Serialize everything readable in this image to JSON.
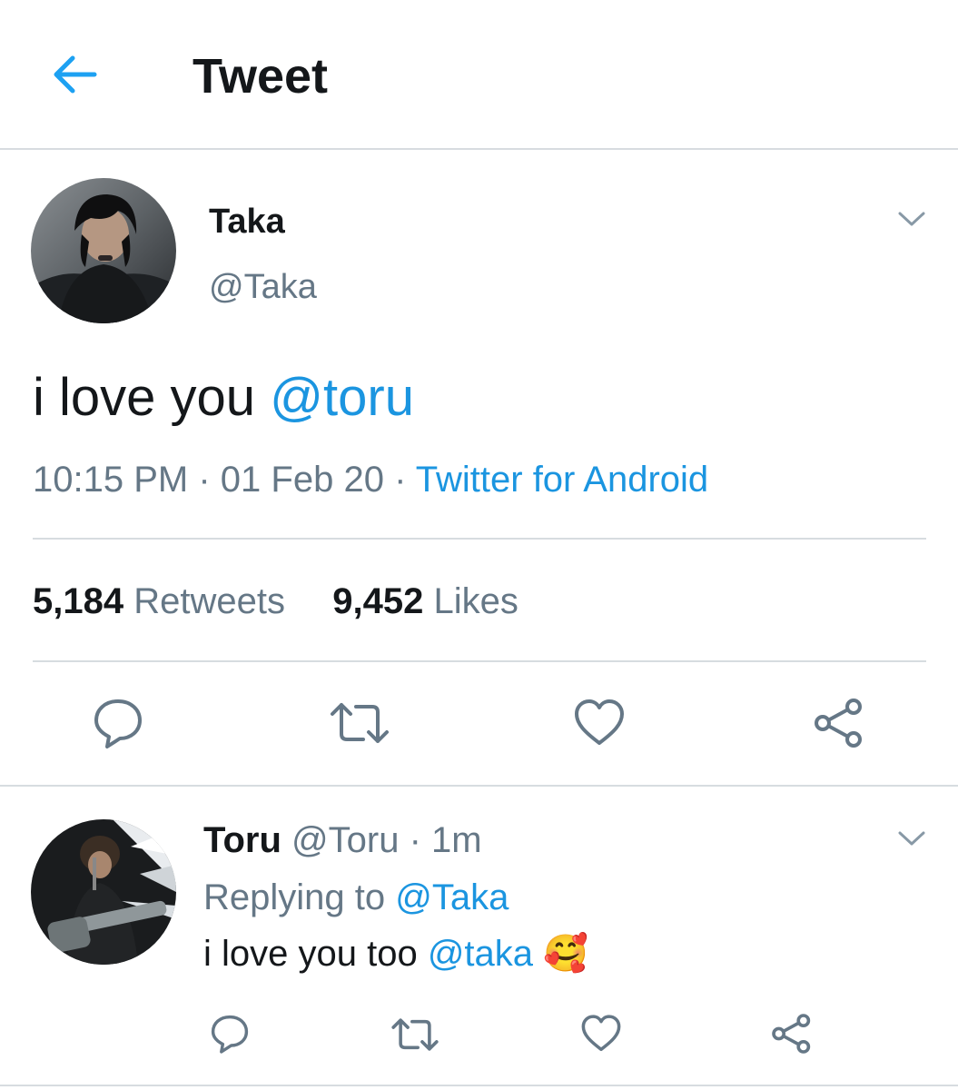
{
  "header": {
    "title": "Tweet",
    "back_icon": "arrow-left-icon",
    "accent": "#1da1f2"
  },
  "tweet": {
    "author": {
      "name": "Taka",
      "handle": "@Taka"
    },
    "text": "i love you",
    "mention": "@toru",
    "time": "10:15 PM",
    "separator": "·",
    "date": "01 Feb 20",
    "source": "Twitter for Android",
    "stats": {
      "retweets_count": "5,184",
      "retweets_label": "Retweets",
      "likes_count": "9,452",
      "likes_label": "Likes"
    },
    "actions": [
      "reply-icon",
      "retweet-icon",
      "like-icon",
      "share-icon"
    ]
  },
  "reply": {
    "author": {
      "name": "Toru",
      "handle": "@Toru"
    },
    "separator": "·",
    "age": "1m",
    "replying_label": "Replying to",
    "replying_to": "@Taka",
    "text": "i love you too",
    "mention": "@taka",
    "emoji": "🥰",
    "actions": [
      "reply-icon",
      "retweet-icon",
      "like-icon",
      "share-icon"
    ]
  },
  "colors": {
    "link": "#1b95e0",
    "muted": "#657786",
    "divider": "#d7dce0",
    "icon": "#657786"
  }
}
